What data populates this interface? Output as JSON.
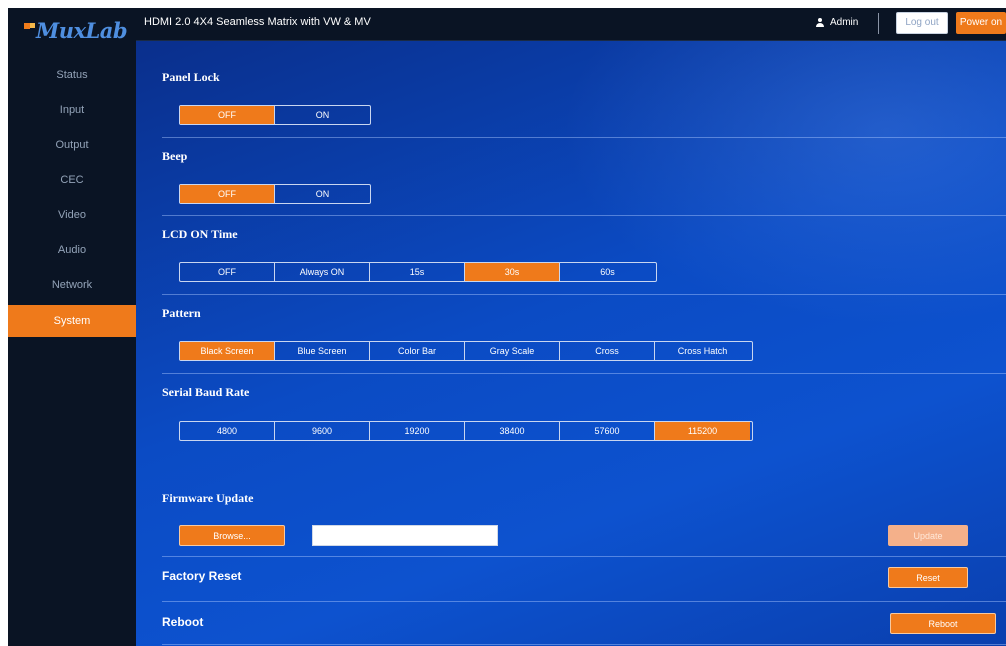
{
  "brand": {
    "logo_text": "MuxLab",
    "colors": {
      "accent": "#ef7a1b",
      "sidebar": "#0a1424",
      "main": "#0b4bc4"
    }
  },
  "header": {
    "title": "HDMI 2.0 4X4 Seamless Matrix with VW & MV",
    "user": "Admin",
    "logout_label": "Log out",
    "power_label": "Power on"
  },
  "sidebar": {
    "items": [
      {
        "label": "Status"
      },
      {
        "label": "Input"
      },
      {
        "label": "Output"
      },
      {
        "label": "CEC"
      },
      {
        "label": "Video"
      },
      {
        "label": "Audio"
      },
      {
        "label": "Network"
      },
      {
        "label": "System",
        "active": true
      }
    ]
  },
  "sections": {
    "panel_lock": {
      "title": "Panel Lock",
      "options": [
        "OFF",
        "ON"
      ],
      "selected": "OFF"
    },
    "beep": {
      "title": "Beep",
      "options": [
        "OFF",
        "ON"
      ],
      "selected": "OFF"
    },
    "lcd_on_time": {
      "title": "LCD ON Time",
      "options": [
        "OFF",
        "Always ON",
        "15s",
        "30s",
        "60s"
      ],
      "selected": "30s"
    },
    "pattern": {
      "title": "Pattern",
      "options": [
        "Black Screen",
        "Blue Screen",
        "Color Bar",
        "Gray Scale",
        "Cross",
        "Cross Hatch"
      ],
      "selected": "Black Screen"
    },
    "serial_baud_rate": {
      "title": "Serial Baud Rate",
      "options": [
        "4800",
        "9600",
        "19200",
        "38400",
        "57600",
        "115200"
      ],
      "selected": "115200"
    },
    "firmware_update": {
      "title": "Firmware Update",
      "browse_label": "Browse...",
      "file_value": "",
      "update_label": "Update"
    },
    "factory_reset": {
      "title": "Factory Reset",
      "button_label": "Reset"
    },
    "reboot": {
      "title": "Reboot",
      "button_label": "Reboot"
    }
  },
  "icons": {
    "user": "user-icon"
  }
}
